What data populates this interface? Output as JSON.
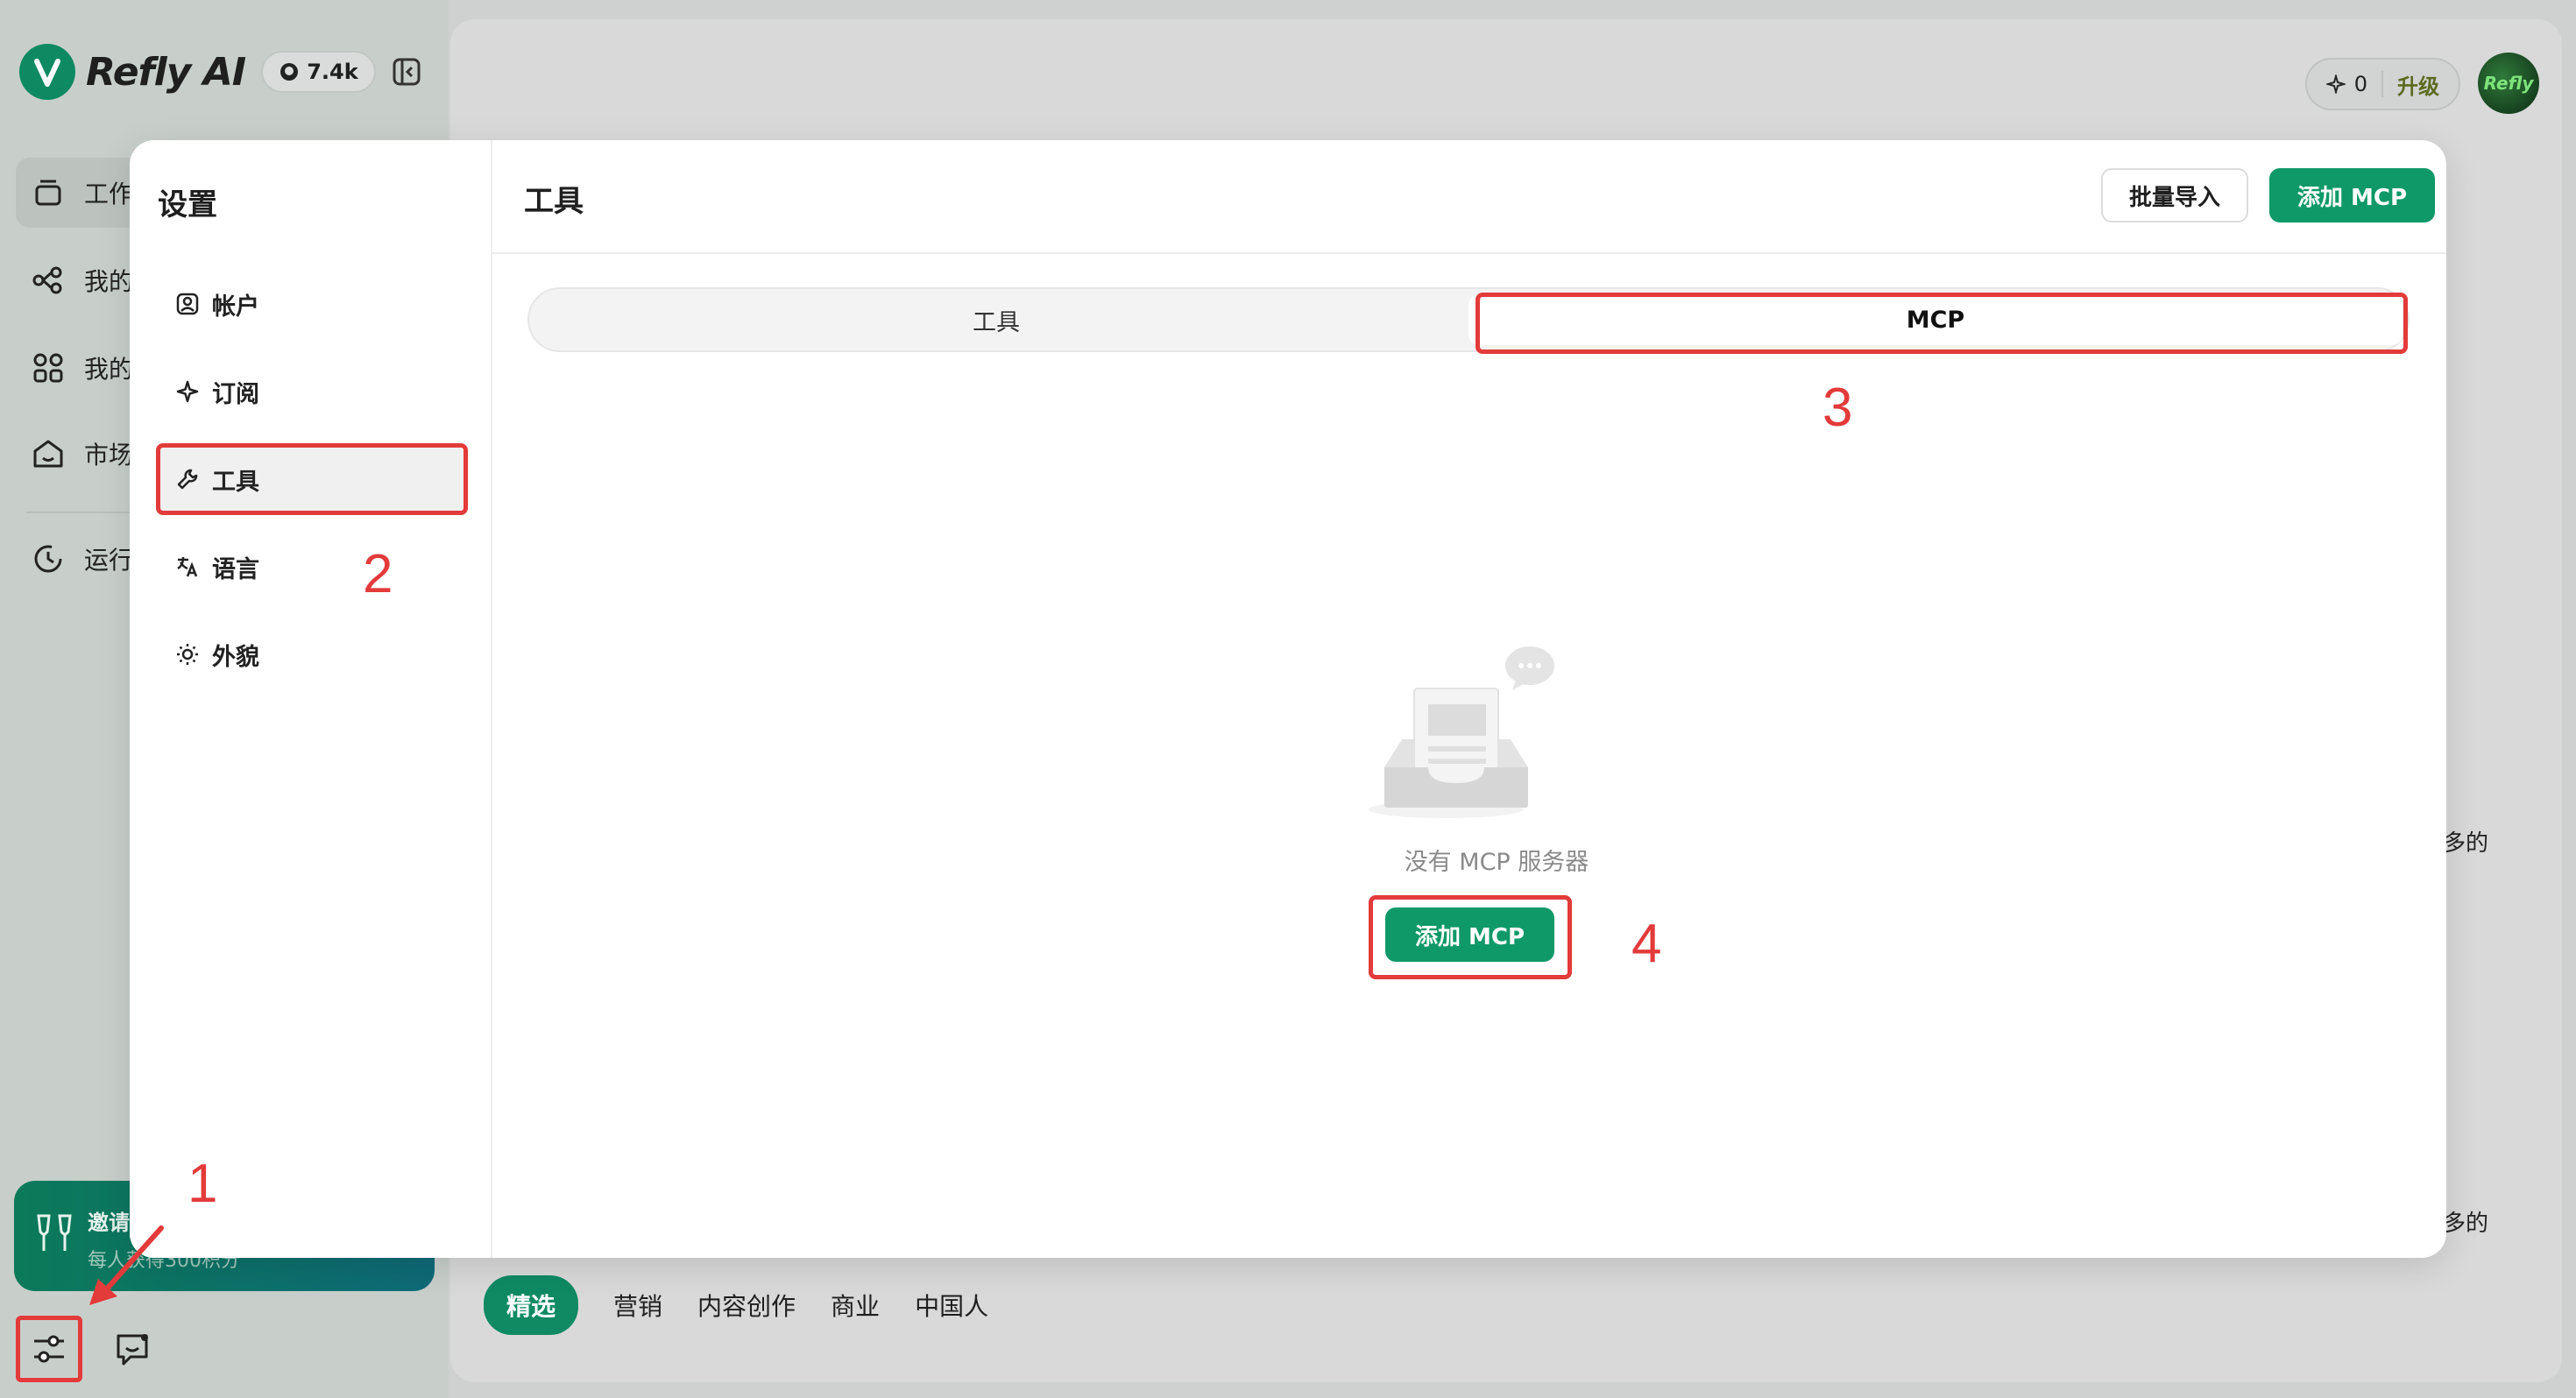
{
  "app": {
    "brand_name": "Refly AI",
    "github_stars": "7.4k",
    "nav": [
      {
        "label": "工作"
      },
      {
        "label": "我的"
      },
      {
        "label": "我的"
      },
      {
        "label": "市场"
      },
      {
        "label": "运行"
      }
    ],
    "invite": {
      "title": "邀请",
      "subtitle": "每人获得300积分"
    },
    "credits": {
      "value": "0",
      "upgrade_label": "升级"
    },
    "avatar_label": "Refly",
    "side_text_1": "多的",
    "side_text_2": "多的",
    "chips": [
      "精选",
      "营销",
      "内容创作",
      "商业",
      "中国人"
    ]
  },
  "settings": {
    "title": "设置",
    "menu": [
      {
        "label": "帐户",
        "icon": "account-icon"
      },
      {
        "label": "订阅",
        "icon": "sparkle-icon"
      },
      {
        "label": "工具",
        "icon": "wrench-icon"
      },
      {
        "label": "语言",
        "icon": "translate-icon"
      },
      {
        "label": "外貌",
        "icon": "sun-icon"
      }
    ],
    "panel": {
      "title": "工具",
      "batch_import_label": "批量导入",
      "add_mcp_label": "添加 MCP",
      "tabs": [
        {
          "label": "工具"
        },
        {
          "label": "MCP"
        }
      ],
      "empty_text": "没有 MCP 服务器",
      "empty_add_label": "添加 MCP"
    }
  },
  "annotations": {
    "n1": "1",
    "n2": "2",
    "n3": "3",
    "n4": "4"
  },
  "colors": {
    "accent": "#0f9968",
    "annotation": "#e33a3a"
  }
}
